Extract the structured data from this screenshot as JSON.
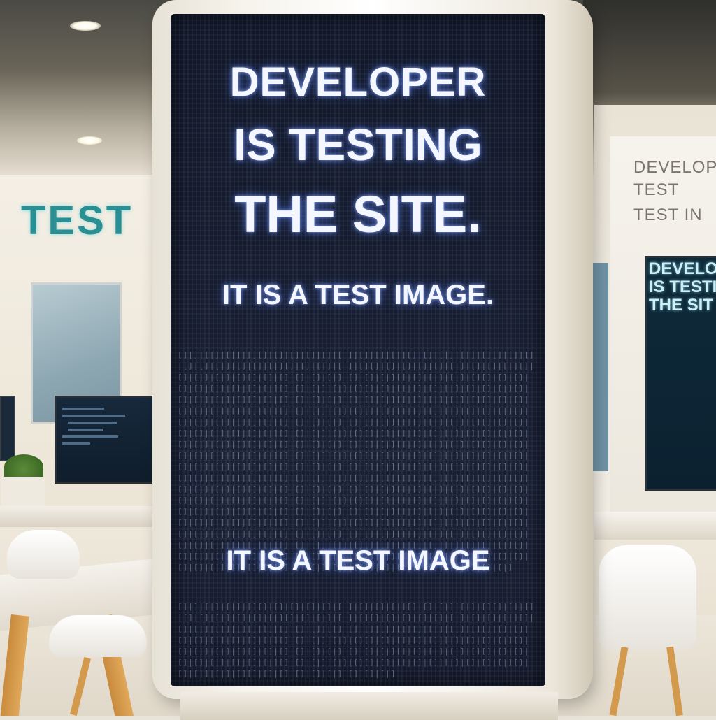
{
  "screen": {
    "headline_line1": "DEVELOPER",
    "headline_line2": "IS TESTING",
    "headline_line3": "THE SITE.",
    "subtext_upper": "IT IS A TEST IMAGE.",
    "subtext_lower": "IT IS A TEST IMAGE"
  },
  "background": {
    "wall_sign": "TEST",
    "right_sign_lines": [
      "DEVELOPER",
      "TEST",
      "TEST IN"
    ],
    "right_screen_lines": [
      "DEVELOP",
      "IS TESTI",
      "THE SIT"
    ]
  },
  "colors": {
    "screen_text": "#f4f7ff",
    "screen_glow": "#5078ff",
    "wall_sign_text": "#2a8f93"
  }
}
